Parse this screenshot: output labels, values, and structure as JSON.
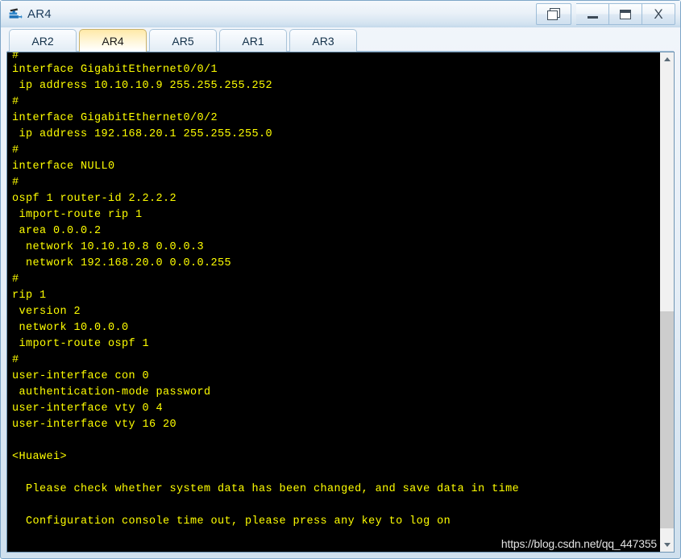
{
  "window": {
    "title": "AR4",
    "icon": "router-icon",
    "buttons": [
      {
        "name": "restore-window-button",
        "icon": "restore-windows-icon",
        "label": ""
      },
      {
        "name": "minimize-button",
        "icon": "minimize-icon",
        "label": ""
      },
      {
        "name": "maximize-button",
        "icon": "maximize-icon",
        "label": ""
      },
      {
        "name": "close-button",
        "icon": "close-icon",
        "label": "X"
      }
    ]
  },
  "tabs": [
    {
      "label": "AR2",
      "active": false
    },
    {
      "label": "AR4",
      "active": true
    },
    {
      "label": "AR5",
      "active": false
    },
    {
      "label": "AR1",
      "active": false
    },
    {
      "label": "AR3",
      "active": false
    }
  ],
  "terminal": {
    "foreground": "#ffff00",
    "background": "#000000",
    "lines": [
      "#",
      "interface GigabitEthernet0/0/1",
      " ip address 10.10.10.9 255.255.255.252",
      "#",
      "interface GigabitEthernet0/0/2",
      " ip address 192.168.20.1 255.255.255.0",
      "#",
      "interface NULL0",
      "#",
      "ospf 1 router-id 2.2.2.2",
      " import-route rip 1",
      " area 0.0.0.2",
      "  network 10.10.10.8 0.0.0.3",
      "  network 192.168.20.0 0.0.0.255",
      "#",
      "rip 1",
      " version 2",
      " network 10.0.0.0",
      " import-route ospf 1",
      "#",
      "user-interface con 0",
      " authentication-mode password",
      "user-interface vty 0 4",
      "user-interface vty 16 20",
      "",
      "<Huawei>",
      "",
      "  Please check whether system data has been changed, and save data in time",
      "",
      "  Configuration console time out, please press any key to log on"
    ]
  },
  "watermark": {
    "text": "https://blog.csdn.net/qq_447355"
  },
  "scrollbar": {
    "up_arrow": "chevron-up-icon",
    "down_arrow": "chevron-down-icon",
    "thumb_top_percent": 52,
    "thumb_height_percent": 46
  }
}
